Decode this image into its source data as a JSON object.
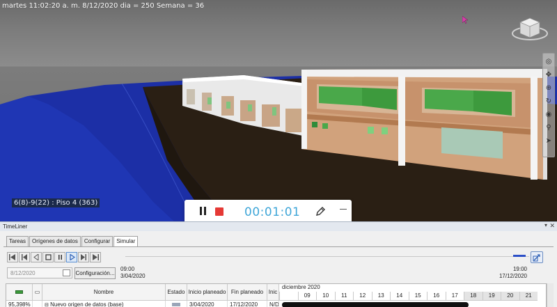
{
  "viewport": {
    "status_line": "martes 11:02:20 a. m. 8/12/2020 dia = 250 Semana = 36",
    "element_label": "6(8)-9(22) : Piso 4 (363)"
  },
  "recorder": {
    "elapsed": "00:01:01",
    "icons": [
      "pause-icon",
      "stop-icon",
      "pen-icon",
      "minimize-icon"
    ],
    "stop_color": "#e53935",
    "time_color": "#3fa6d8"
  },
  "timeliner": {
    "title": "TimeLiner",
    "tabs": [
      "Tareas",
      "Orígenes de datos",
      "Configurar",
      "Simular"
    ],
    "active_tab": "Simular",
    "date_value": "8/12/2020",
    "config_button": "Configuración...",
    "start": {
      "time": "09:00",
      "date": "3/04/2020"
    },
    "end": {
      "time": "19:00",
      "date": "17/12/2020"
    },
    "progress": 0.96,
    "columns": [
      "",
      "",
      "Nombre",
      "Estado",
      "Inicio planeado",
      "Fin planeado",
      "Inic"
    ],
    "row": {
      "percent": "95,398%",
      "name": "Nuevo origen de datos (base)",
      "state": "",
      "planned_start": "3/04/2020",
      "planned_end": "17/12/2020",
      "actual_start": "N/D"
    },
    "gantt": {
      "month": "diciembre 2020",
      "days": [
        "",
        "09",
        "10",
        "11",
        "12",
        "13",
        "14",
        "15",
        "16",
        "17",
        "18",
        "19",
        "20",
        "21"
      ],
      "current_day_index": 9
    }
  }
}
